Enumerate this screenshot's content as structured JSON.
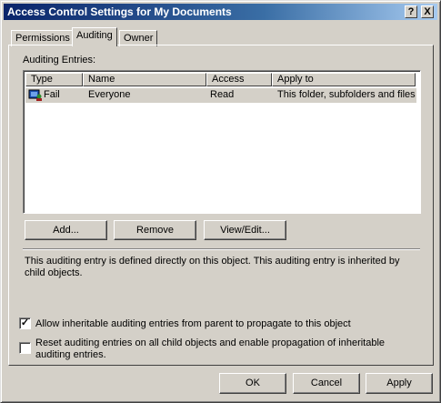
{
  "window": {
    "title": "Access Control Settings for My Documents"
  },
  "titlebar": {
    "help_label": "?",
    "close_label": "X"
  },
  "tabs": [
    {
      "label": "Permissions"
    },
    {
      "label": "Auditing"
    },
    {
      "label": "Owner"
    }
  ],
  "auditing": {
    "entries_label": "Auditing Entries:",
    "columns": [
      "Type",
      "Name",
      "Access",
      "Apply to"
    ],
    "rows": [
      {
        "type": "Fail",
        "name": "Everyone",
        "access": "Read",
        "apply_to": "This folder, subfolders and files"
      }
    ],
    "buttons": {
      "add": "Add...",
      "remove": "Remove",
      "view_edit": "View/Edit..."
    },
    "description": "This auditing entry is defined directly on this object. This auditing entry is inherited by child objects.",
    "allow_inherit": {
      "label": "Allow inheritable auditing entries from parent to propagate to this object",
      "checked": true
    },
    "reset_children": {
      "label": "Reset auditing entries on all child objects and enable propagation of inheritable auditing entries.",
      "checked": false
    }
  },
  "footer": {
    "ok": "OK",
    "cancel": "Cancel",
    "apply": "Apply"
  }
}
